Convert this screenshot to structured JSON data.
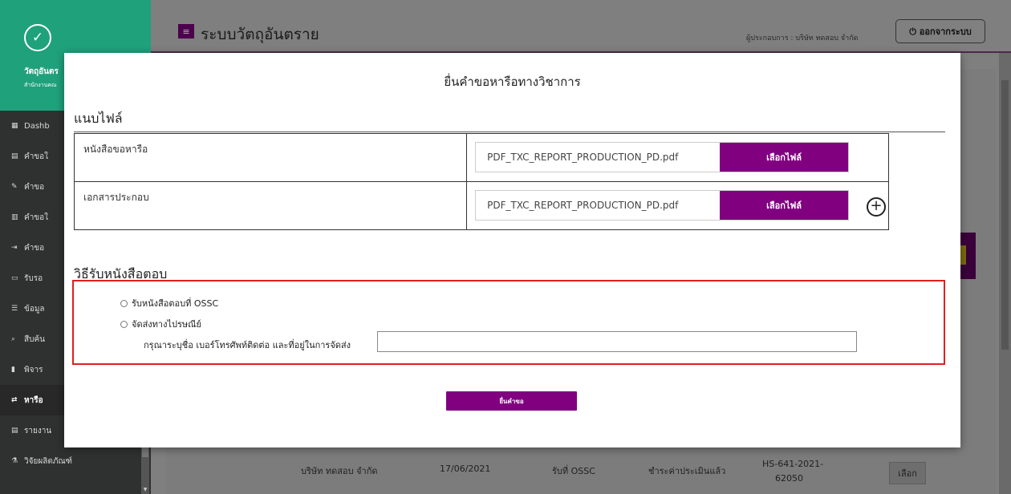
{
  "sidebar": {
    "logo_glyph": "✓",
    "title": "วัตถุอันตร",
    "subtitle": "สำนักงานคณ",
    "items": [
      {
        "icon": "▦",
        "label": "Dashb"
      },
      {
        "icon": "▤",
        "label": "คำขอใ"
      },
      {
        "icon": "✎",
        "label": "คำขอ"
      },
      {
        "icon": "▥",
        "label": "คำขอใ"
      },
      {
        "icon": "⇥",
        "label": "คำขอ"
      },
      {
        "icon": "▭",
        "label": "รับรอ"
      },
      {
        "icon": "☰",
        "label": "ข้อมูล"
      },
      {
        "icon": "⌕",
        "label": "สืบค้น"
      },
      {
        "icon": "▮",
        "label": "พิจาร"
      },
      {
        "icon": "⇄",
        "label": "หารือ"
      },
      {
        "icon": "▤",
        "label": "รายงาน"
      },
      {
        "icon": "⚗",
        "label": "วิจัยผลิตภัณฑ์"
      }
    ]
  },
  "header": {
    "menu_icon": "≡",
    "title": "ระบบวัตถุอันตราย",
    "user_label": "ผู้ประกอบการ : บริษัท ทดสอบ จำกัด",
    "logout_label": "⏻ ออกจากระบบ"
  },
  "background_row": {
    "company": "บริษัท ทดสอบ จำกัด",
    "date": "17/06/2021",
    "receive": "รับที่ OSSC",
    "status": "ชำระค่าประเมินแล้ว",
    "ref_line1": "HS-641-2021-",
    "ref_line2": "62050",
    "select_label": "เลือก"
  },
  "modal": {
    "title": "ยื่นคำขอหารือทางวิชาการ",
    "attach_section": "แนบไฟล์",
    "files": [
      {
        "label": "หนังสือขอหารือ",
        "filename": "PDF_TXC_REPORT_PRODUCTION_PD.pdf",
        "button": "เลือกไฟล์"
      },
      {
        "label": "เอกสารประกอบ",
        "filename": "PDF_TXC_REPORT_PRODUCTION_PD.pdf",
        "button": "เลือกไฟล์"
      }
    ],
    "add_glyph": "+",
    "reply_section": "วิธีรับหนังสือตอบ",
    "options": [
      {
        "label": "รับหนังสือตอบที่ OSSC"
      },
      {
        "label": "จัดส่งทางไปรษณีย์"
      }
    ],
    "address_label": "กรุณาระบุชื่อ เบอร์โทรศัพท์ติดต่อ และที่อยู่ในการจัดส่ง",
    "address_value": "",
    "submit_label": "ยื่นคำขอ"
  },
  "colors": {
    "brand_purple": "#800080",
    "highlight_red": "#e01f1f",
    "sidebar_green": "#1fa17c"
  }
}
